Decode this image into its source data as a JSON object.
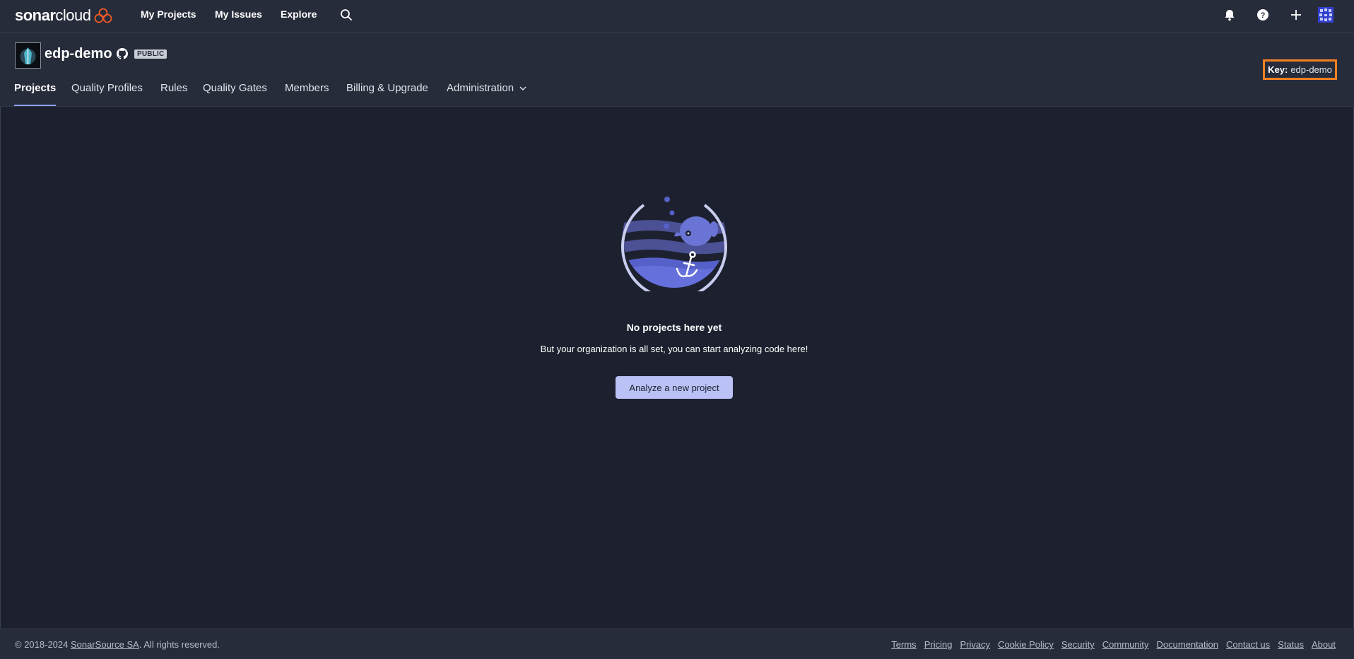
{
  "topnav": {
    "logo_bold": "sonar",
    "logo_light": "cloud",
    "links": [
      "My Projects",
      "My Issues",
      "Explore"
    ],
    "icons": [
      "search-icon",
      "bell-icon",
      "help-icon",
      "plus-icon",
      "user-avatar"
    ]
  },
  "org": {
    "name": "edp-demo",
    "badge": "PUBLIC",
    "key_label": "Key:",
    "key_value": "edp-demo"
  },
  "tabs": [
    "Projects",
    "Quality Profiles",
    "Rules",
    "Quality Gates",
    "Members",
    "Billing & Upgrade",
    "Administration"
  ],
  "active_tab": "Projects",
  "empty_state": {
    "title": "No projects here yet",
    "description": "But your organization is all set, you can start analyzing code here!",
    "button": "Analyze a new project"
  },
  "footer": {
    "copyright_prefix": "© 2018-2024 ",
    "copyright_link": "SonarSource SA",
    "copyright_suffix": ". All rights reserved.",
    "links": [
      "Terms",
      "Pricing",
      "Privacy",
      "Cookie Policy",
      "Security",
      "Community",
      "Documentation",
      "Contact us",
      "Status",
      "About"
    ]
  },
  "colors": {
    "background": "#1d212f",
    "header": "#272c3b",
    "accent": "#b9c1f5",
    "key_highlight": "#f58220",
    "logo_accent": "#f15a24"
  }
}
